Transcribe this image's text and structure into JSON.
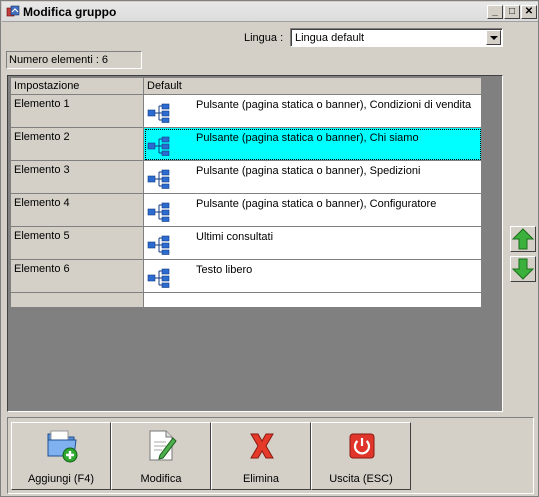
{
  "window": {
    "title": "Modifica gruppo"
  },
  "language": {
    "label": "Lingua :",
    "value": "Lingua default"
  },
  "count_label": "Numero elementi : 6",
  "grid": {
    "columns": [
      "Impostazione",
      "Default"
    ],
    "rows": [
      {
        "name": "Elemento 1",
        "value": "Pulsante (pagina statica o banner), Condizioni di vendita"
      },
      {
        "name": "Elemento 2",
        "value": "Pulsante (pagina statica o banner), Chi siamo"
      },
      {
        "name": "Elemento 3",
        "value": "Pulsante (pagina statica o banner), Spedizioni"
      },
      {
        "name": "Elemento 4",
        "value": "Pulsante (pagina statica o banner), Configuratore"
      },
      {
        "name": "Elemento 5",
        "value": "Ultimi consultati"
      },
      {
        "name": "Elemento 6",
        "value": "Testo libero"
      }
    ],
    "selected_row": "Elemento 2",
    "selected_color": "#00ffff"
  },
  "toolbar": {
    "add_label": "Aggiungi (F4)",
    "edit_label": "Modifica",
    "delete_label": "Elimina",
    "exit_label": "Uscita (ESC)"
  },
  "icons": {
    "up": "arrow-up-icon",
    "down": "arrow-down-icon",
    "row": "tree-structure-icon"
  }
}
